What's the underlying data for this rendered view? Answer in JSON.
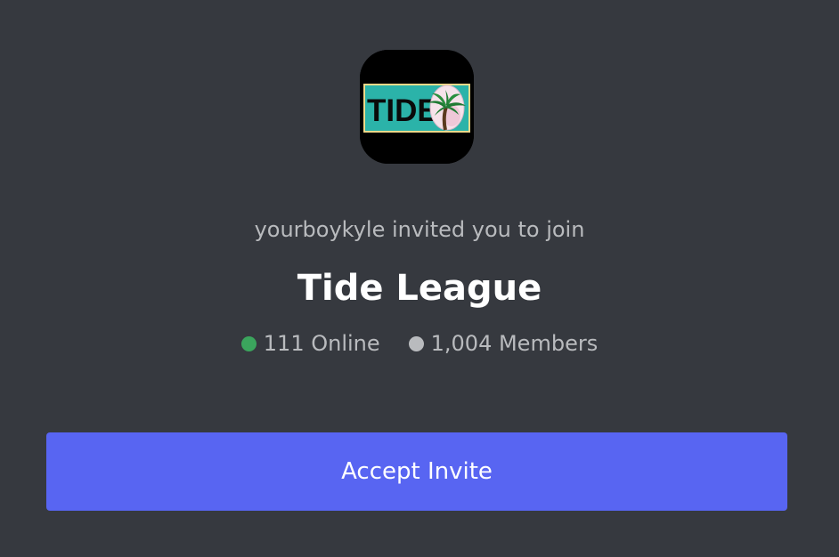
{
  "invite": {
    "inviter_text": "yourboykyle invited you to join",
    "server_name": "Tide League",
    "server_icon": "tide-league-logo",
    "icon_text": "TIDE",
    "online": "111 Online",
    "members": "1,004 Members",
    "accept_label": "Accept Invite"
  },
  "colors": {
    "background": "#36393f",
    "accent": "#5865f2",
    "online": "#3ba55d",
    "members": "#b9bbbe"
  }
}
